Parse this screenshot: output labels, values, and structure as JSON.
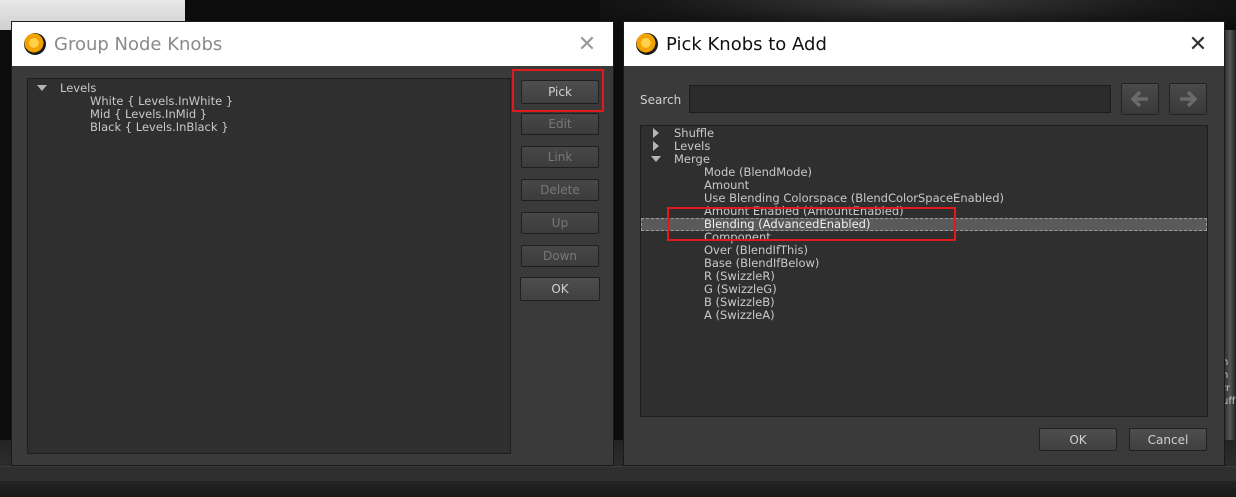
{
  "left_dialog": {
    "title": "Group Node Knobs",
    "tree": {
      "group": "Levels",
      "children": [
        "White { Levels.InWhite }",
        "Mid { Levels.InMid }",
        "Black { Levels.InBlack }"
      ]
    },
    "buttons": {
      "pick": "Pick",
      "edit": "Edit",
      "link": "Link",
      "delete": "Delete",
      "up": "Up",
      "down": "Down",
      "ok": "OK"
    }
  },
  "right_dialog": {
    "title": "Pick Knobs to Add",
    "search": {
      "label": "Search",
      "value": ""
    },
    "tree": {
      "collapsed": [
        "Shuffle",
        "Levels"
      ],
      "expanded_group": "Merge",
      "children": [
        "Mode (BlendMode)",
        "Amount",
        "Use Blending Colorspace (BlendColorSpaceEnabled)",
        "Amount Enabled (AmountEnabled)",
        "Blending (AdvancedEnabled)",
        "Component",
        "Over (BlendIfThis)",
        "Base (BlendIfBelow)",
        "R (SwizzleR)",
        "G (SwizzleG)",
        "B (SwizzleB)",
        "A (SwizzleA)"
      ],
      "selected": "Blending (AdvancedEnabled)"
    },
    "buttons": {
      "ok": "OK",
      "cancel": "Cancel"
    }
  },
  "background": {
    "side_text": [
      "h",
      "h",
      "rr",
      "",
      "uff"
    ]
  },
  "colors": {
    "highlight": "#e11b1b",
    "dialog_bg": "#3a3a3a",
    "titlebar": "#ffffff"
  },
  "icons": [
    "app-icon",
    "close-icon",
    "arrow-left-icon",
    "arrow-right-icon",
    "triangle-down-icon",
    "triangle-right-icon"
  ]
}
